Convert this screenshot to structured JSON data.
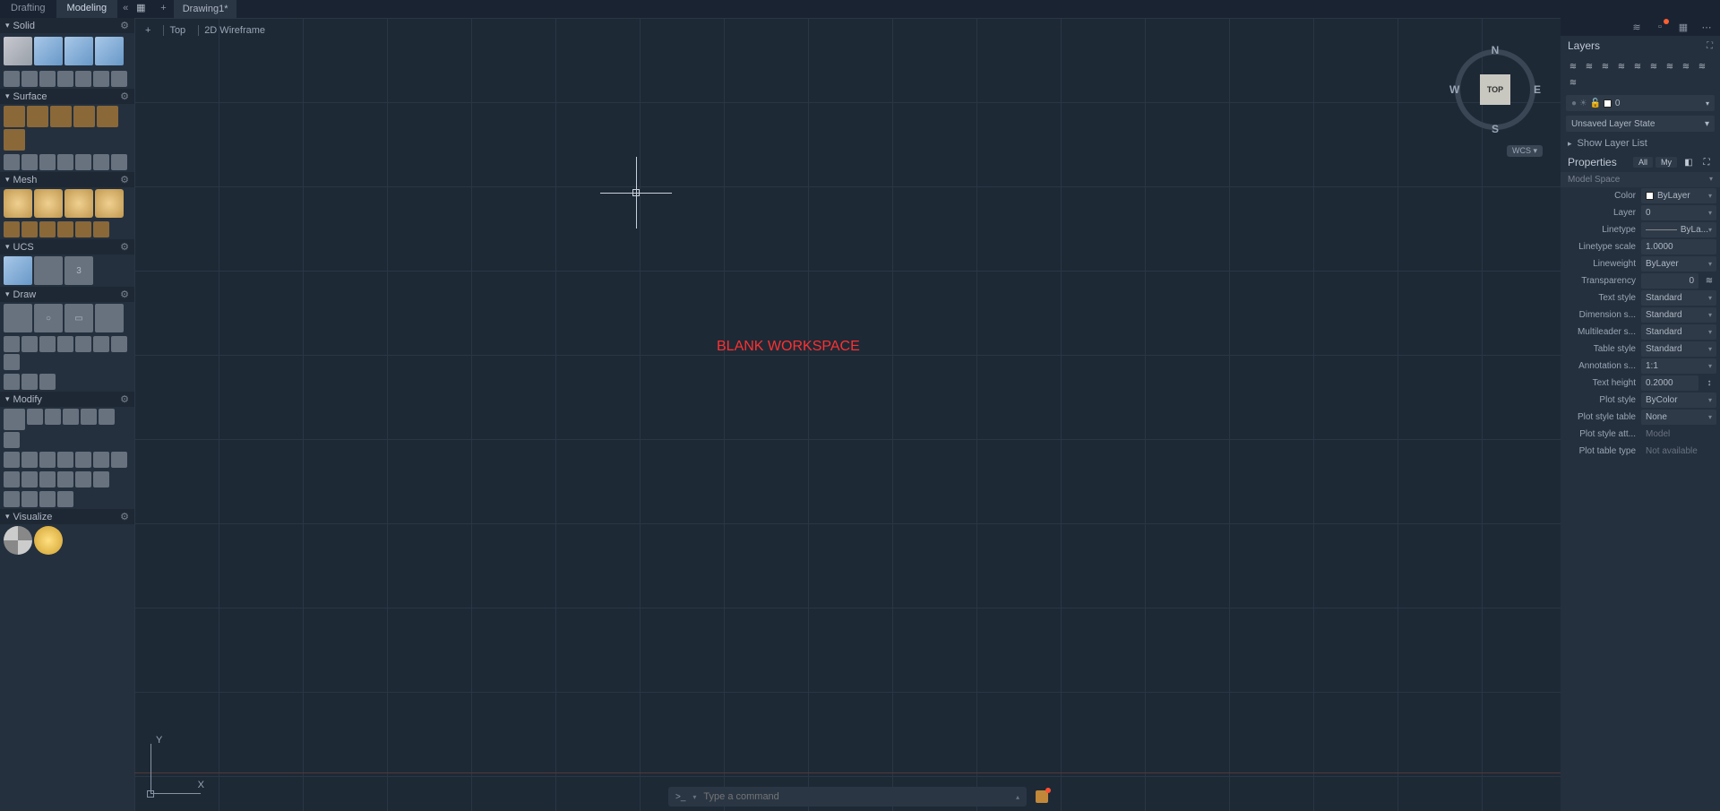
{
  "modes": {
    "drafting": "Drafting",
    "modeling": "Modeling"
  },
  "doc_tab": "Drawing1*",
  "view": {
    "plus": "+",
    "top": "Top",
    "style": "2D Wireframe"
  },
  "viewcube": {
    "face": "TOP",
    "n": "N",
    "s": "S",
    "e": "E",
    "w": "W",
    "wcs": "WCS"
  },
  "axis": {
    "x": "X",
    "y": "Y"
  },
  "annotation": "BLANK WORKSPACE",
  "cmd": {
    "prompt": ">_",
    "placeholder": "Type a command"
  },
  "sections": {
    "solid": "Solid",
    "surface": "Surface",
    "mesh": "Mesh",
    "ucs": "UCS",
    "draw": "Draw",
    "modify": "Modify",
    "visualize": "Visualize"
  },
  "layers": {
    "title": "Layers",
    "current": "0",
    "state": "Unsaved Layer State",
    "show_list": "Show Layer List"
  },
  "props": {
    "title": "Properties",
    "tab_all": "All",
    "tab_my": "My",
    "context": "Model Space",
    "rows": {
      "color": {
        "label": "Color",
        "value": "ByLayer"
      },
      "layer": {
        "label": "Layer",
        "value": "0"
      },
      "linetype": {
        "label": "Linetype",
        "value": "ByLa..."
      },
      "linetype_scale": {
        "label": "Linetype scale",
        "value": "1.0000"
      },
      "lineweight": {
        "label": "Lineweight",
        "value": "ByLayer"
      },
      "transparency": {
        "label": "Transparency",
        "value": "0"
      },
      "text_style": {
        "label": "Text style",
        "value": "Standard"
      },
      "dimension_style": {
        "label": "Dimension s...",
        "value": "Standard"
      },
      "multileader_style": {
        "label": "Multileader s...",
        "value": "Standard"
      },
      "table_style": {
        "label": "Table style",
        "value": "Standard"
      },
      "annotation_scale": {
        "label": "Annotation s...",
        "value": "1:1"
      },
      "text_height": {
        "label": "Text height",
        "value": "0.2000"
      },
      "plot_style": {
        "label": "Plot style",
        "value": "ByColor"
      },
      "plot_style_table": {
        "label": "Plot style table",
        "value": "None"
      },
      "plot_style_attached": {
        "label": "Plot style att...",
        "value": "Model"
      },
      "plot_table_type": {
        "label": "Plot table type",
        "value": "Not available"
      }
    }
  }
}
